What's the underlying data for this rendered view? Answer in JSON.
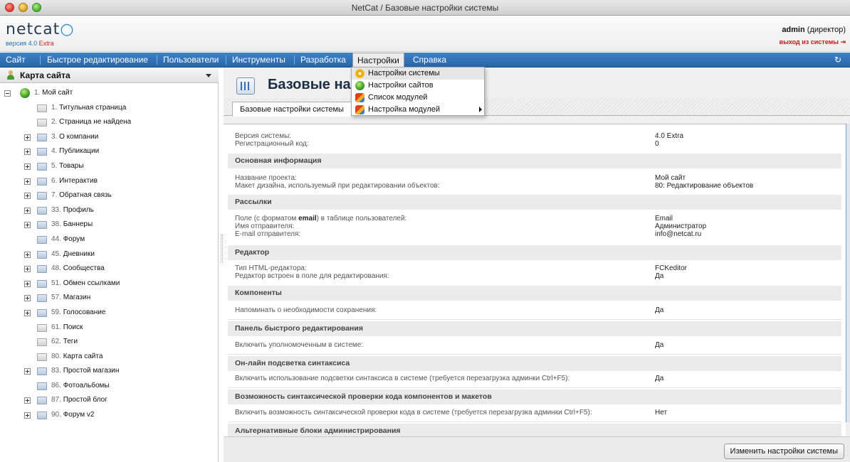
{
  "window": {
    "title": "NetCat / Базовые настройки системы"
  },
  "header": {
    "logo": "netcat",
    "version_label": "версия",
    "version": "4.0",
    "edition": "Extra",
    "user_name": "admin",
    "user_role": "(директор)",
    "logout": "выход из системы"
  },
  "menu": {
    "items": [
      "Сайт",
      "Быстрое редактирование",
      "Пользователи",
      "Инструменты",
      "Разработка",
      "Настройки",
      "Справка"
    ],
    "active": "Настройки"
  },
  "dropdown": {
    "items": [
      {
        "label": "Настройки системы",
        "icon": "gear-icon"
      },
      {
        "label": "Настройки сайтов",
        "icon": "globe-icon"
      },
      {
        "label": "Список модулей",
        "icon": "modules-icon"
      },
      {
        "label": "Настройка модулей",
        "icon": "modules-icon"
      }
    ]
  },
  "sidebar": {
    "title": "Карта сайта",
    "tree": [
      {
        "num": "1.",
        "label": "Мой сайт"
      },
      {
        "num": "1.",
        "label": "Титульная страница"
      },
      {
        "num": "2.",
        "label": "Страница не найдена"
      },
      {
        "num": "3.",
        "label": "О компании"
      },
      {
        "num": "4.",
        "label": "Публикации"
      },
      {
        "num": "5.",
        "label": "Товары"
      },
      {
        "num": "6.",
        "label": "Интерактив"
      },
      {
        "num": "7.",
        "label": "Обратная связь"
      },
      {
        "num": "33.",
        "label": "Профиль"
      },
      {
        "num": "38.",
        "label": "Баннеры"
      },
      {
        "num": "44.",
        "label": "Форум"
      },
      {
        "num": "45.",
        "label": "Дневники"
      },
      {
        "num": "48.",
        "label": "Сообщества"
      },
      {
        "num": "51.",
        "label": "Обмен ссылками"
      },
      {
        "num": "57.",
        "label": "Магазин"
      },
      {
        "num": "59.",
        "label": "Голосование"
      },
      {
        "num": "61.",
        "label": "Поиск"
      },
      {
        "num": "62.",
        "label": "Теги"
      },
      {
        "num": "80.",
        "label": "Карта сайта"
      },
      {
        "num": "83.",
        "label": "Простой магазин"
      },
      {
        "num": "86.",
        "label": "Фотоальбомы"
      },
      {
        "num": "87.",
        "label": "Простой блог"
      },
      {
        "num": "90.",
        "label": "Форум v2"
      }
    ]
  },
  "main": {
    "title": "Базовые настройки системы",
    "tab": "Базовые настройки системы",
    "top": {
      "k1": "Версия системы:",
      "v1": "4.0 Extra",
      "k2": "Регистрационный код:",
      "v2": "0"
    },
    "sections": {
      "s1": {
        "title": "Основная информация",
        "k1": "Название проекта:",
        "v1": "Мой сайт",
        "k2": "Макет дизайна, используемый при редактировании объектов:",
        "v2": "80: Редактирование объектов"
      },
      "s2": {
        "title": "Рассылки",
        "k1a": "Поле (с форматом ",
        "k1b": "email",
        "k1c": ") в таблице пользователей:",
        "v1": "Email",
        "k2": "Имя отправителя:",
        "v2": "Администратор",
        "k3": "E-mail отправителя:",
        "v3": "info@netcat.ru"
      },
      "s3": {
        "title": "Редактор",
        "k1": "Тип HTML-редактора:",
        "v1": "FCKeditor",
        "k2": "Редактор встроен в поле для редактирования:",
        "v2": "Да"
      },
      "s4": {
        "title": "Компоненты",
        "k1": "Напоминать о необходимости сохранения:",
        "v1": "Да"
      },
      "s5": {
        "title": "Панель быстрого редактирования",
        "k1": "Включить уполномоченным в системе:",
        "v1": "Да"
      },
      "s6": {
        "title": "Он-лайн подсветка синтаксиса",
        "k1": "Включить использование подсветки синтаксиса в системе (требуется перезагрузка админки Ctrl+F5):",
        "v1": "Да"
      },
      "s7": {
        "title": "Возможность синтаксической проверки кода компонентов и макетов",
        "k1": "Включить возможность синтаксической проверки кода в системе (требуется перезагрузка админки Ctrl+F5):",
        "v1": "Нет"
      },
      "s8": {
        "title": "Альтернативные блоки администрирования"
      }
    },
    "save_button": "Изменить настройки системы"
  }
}
